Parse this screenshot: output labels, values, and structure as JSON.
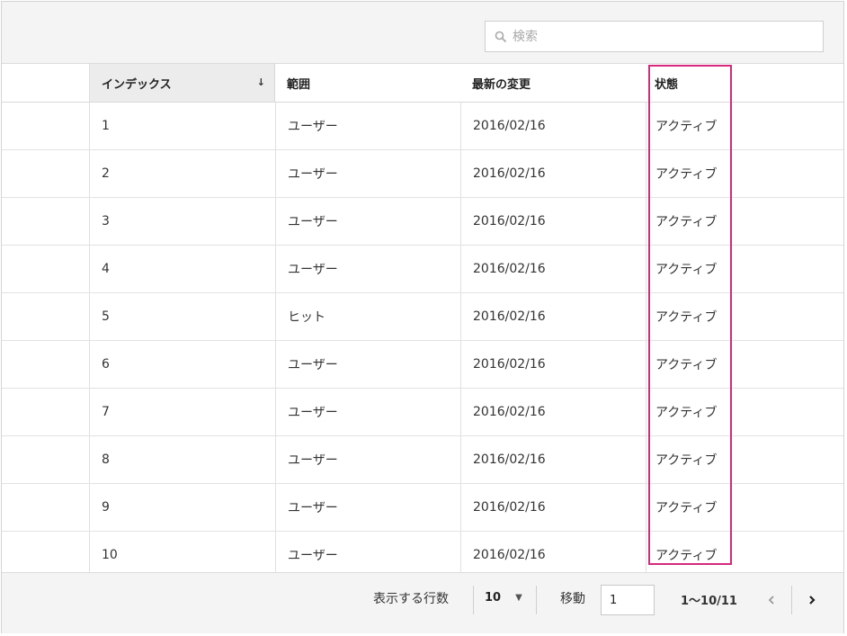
{
  "search": {
    "placeholder": "検索",
    "value": ""
  },
  "columns": {
    "index": "インデックス",
    "scope": "範囲",
    "modified": "最新の変更",
    "state": "状態"
  },
  "rows": [
    {
      "index": "1",
      "scope": "ユーザー",
      "modified": "2016/02/16",
      "state": "アクティブ"
    },
    {
      "index": "2",
      "scope": "ユーザー",
      "modified": "2016/02/16",
      "state": "アクティブ"
    },
    {
      "index": "3",
      "scope": "ユーザー",
      "modified": "2016/02/16",
      "state": "アクティブ"
    },
    {
      "index": "4",
      "scope": "ユーザー",
      "modified": "2016/02/16",
      "state": "アクティブ"
    },
    {
      "index": "5",
      "scope": "ヒット",
      "modified": "2016/02/16",
      "state": "アクティブ"
    },
    {
      "index": "6",
      "scope": "ユーザー",
      "modified": "2016/02/16",
      "state": "アクティブ"
    },
    {
      "index": "7",
      "scope": "ユーザー",
      "modified": "2016/02/16",
      "state": "アクティブ"
    },
    {
      "index": "8",
      "scope": "ユーザー",
      "modified": "2016/02/16",
      "state": "アクティブ"
    },
    {
      "index": "9",
      "scope": "ユーザー",
      "modified": "2016/02/16",
      "state": "アクティブ"
    },
    {
      "index": "10",
      "scope": "ユーザー",
      "modified": "2016/02/16",
      "state": "アクティブ"
    }
  ],
  "footer": {
    "rows_label": "表示する行数",
    "rows_value": "10",
    "goto_label": "移動",
    "goto_value": "1",
    "range": "1〜10/11"
  },
  "colors": {
    "highlight": "#d6287c",
    "toolbar_bg": "#f4f4f4"
  }
}
